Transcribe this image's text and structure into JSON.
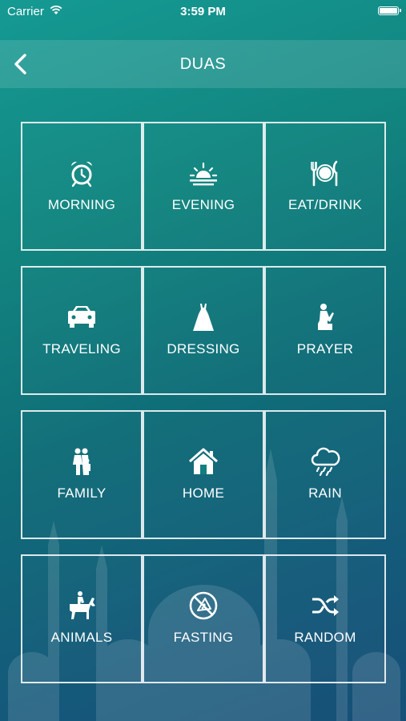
{
  "status": {
    "carrier": "Carrier",
    "time": "3:59 PM"
  },
  "nav": {
    "title": "DUAS",
    "back_icon": "chevron-left-icon"
  },
  "tiles": [
    {
      "label": "MORNING",
      "icon": "alarm-clock-icon"
    },
    {
      "label": "EVENING",
      "icon": "sunset-icon"
    },
    {
      "label": "EAT/DRINK",
      "icon": "plate-cutlery-icon"
    },
    {
      "label": "TRAVELING",
      "icon": "car-icon"
    },
    {
      "label": "DRESSING",
      "icon": "dress-icon"
    },
    {
      "label": "PRAYER",
      "icon": "praying-person-icon"
    },
    {
      "label": "FAMILY",
      "icon": "family-icon"
    },
    {
      "label": "HOME",
      "icon": "house-icon"
    },
    {
      "label": "RAIN",
      "icon": "rain-cloud-icon"
    },
    {
      "label": "ANIMALS",
      "icon": "horse-rider-icon"
    },
    {
      "label": "FASTING",
      "icon": "no-food-icon"
    },
    {
      "label": "RANDOM",
      "icon": "shuffle-icon"
    }
  ],
  "colors": {
    "bg_top": "#159a93",
    "bg_bottom": "#174f78",
    "tile_border": "#ffffff"
  }
}
